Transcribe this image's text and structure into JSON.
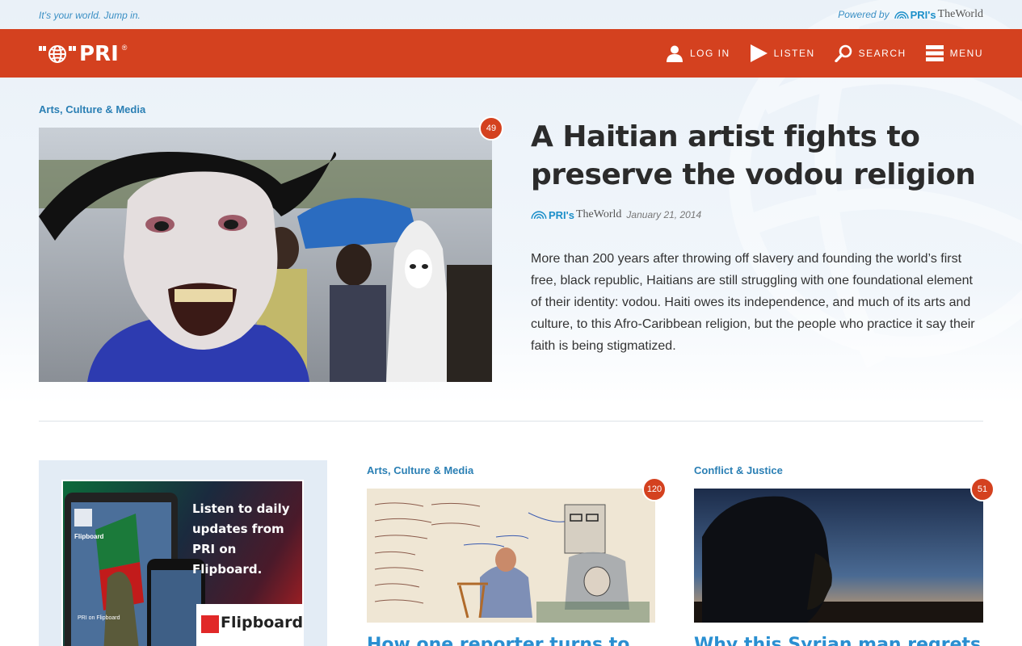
{
  "topbar": {
    "tagline": "It’s your world. Jump in.",
    "powered_by": "Powered by",
    "powered_logo_pri": "PRI's",
    "powered_logo_world": "TheWorld"
  },
  "nav": {
    "brand": "PRI",
    "brand_reg": "®",
    "links": [
      {
        "label": "LOG IN",
        "icon": "user-icon"
      },
      {
        "label": "LISTEN",
        "icon": "play-icon"
      },
      {
        "label": "SEARCH",
        "icon": "search-icon"
      },
      {
        "label": "MENU",
        "icon": "menu-icon"
      }
    ]
  },
  "hero": {
    "category": "Arts, Culture & Media",
    "comments": "49",
    "title": "A Haitian artist fights to preserve the vodou religion",
    "source_pri": "PRI's",
    "source_world": "TheWorld",
    "date": "January 21, 2014",
    "description": "More than 200 years after throwing off slavery and founding the world’s first free, black republic, Haitians are still struggling with one foundational element of their identity: vodou. Haiti owes its independence, and much of its arts and culture, to this Afro-Caribbean religion, but the people who practice it say their faith is being stigmatized."
  },
  "promo": {
    "text": "Listen to daily updates from PRI on Flipboard.",
    "brand": "Flipboard",
    "device_label": "Flipboard",
    "device_caption": "PRI on Flipboard"
  },
  "cards": [
    {
      "category": "Arts, Culture & Media",
      "comments": "120",
      "title": "How one reporter turns to"
    },
    {
      "category": "Conflict & Justice",
      "comments": "51",
      "title": "Why this Syrian man regrets"
    }
  ],
  "colors": {
    "brand_orange": "#d4411f",
    "link_blue": "#2a7fb4",
    "title_blue": "#2a8fd1"
  }
}
